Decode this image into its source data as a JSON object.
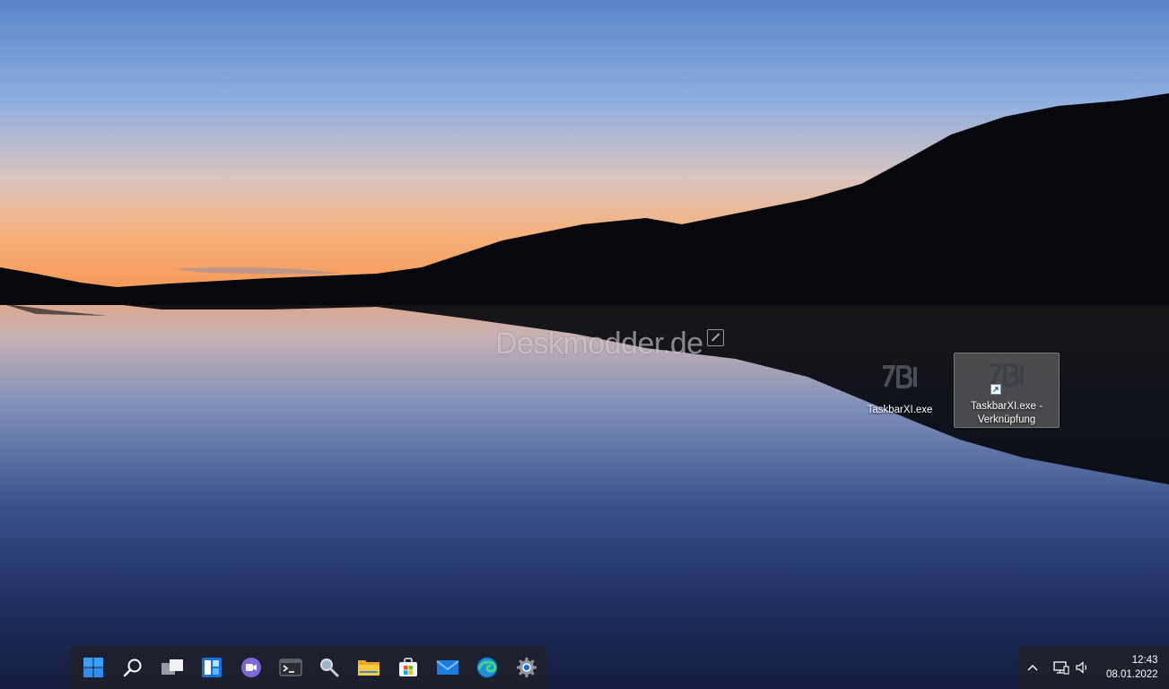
{
  "desktop": {
    "watermark": "Deskmodder.de",
    "icons": [
      {
        "label": "TaskbarXI.exe",
        "icon": "taskbarxi-icon",
        "selected": false
      },
      {
        "label": "TaskbarXI.exe -\nVerknüpfung",
        "icon": "taskbarxi-shortcut-icon",
        "selected": true
      }
    ]
  },
  "taskbar": {
    "apps": [
      {
        "name": "start-button",
        "icon": "windows-logo-icon"
      },
      {
        "name": "search-button",
        "icon": "search-icon"
      },
      {
        "name": "task-view-button",
        "icon": "task-view-icon"
      },
      {
        "name": "widgets-button",
        "icon": "widgets-icon"
      },
      {
        "name": "teams-chat-button",
        "icon": "teams-chat-icon"
      },
      {
        "name": "terminal-button",
        "icon": "terminal-icon"
      },
      {
        "name": "magnifier-button",
        "icon": "magnifier-icon"
      },
      {
        "name": "file-explorer-button",
        "icon": "folder-icon"
      },
      {
        "name": "microsoft-store-button",
        "icon": "store-icon"
      },
      {
        "name": "mail-button",
        "icon": "mail-icon"
      },
      {
        "name": "edge-button",
        "icon": "edge-icon"
      },
      {
        "name": "settings-button",
        "icon": "gear-icon"
      }
    ]
  },
  "tray": {
    "icons": [
      "chevron-up-icon",
      "network-icon",
      "volume-icon"
    ],
    "time": "12:43",
    "date": "08.01.2022"
  },
  "colors": {
    "taskbar_bg": "#1e2028",
    "selection": "#787878",
    "accent": "#0078d4"
  }
}
